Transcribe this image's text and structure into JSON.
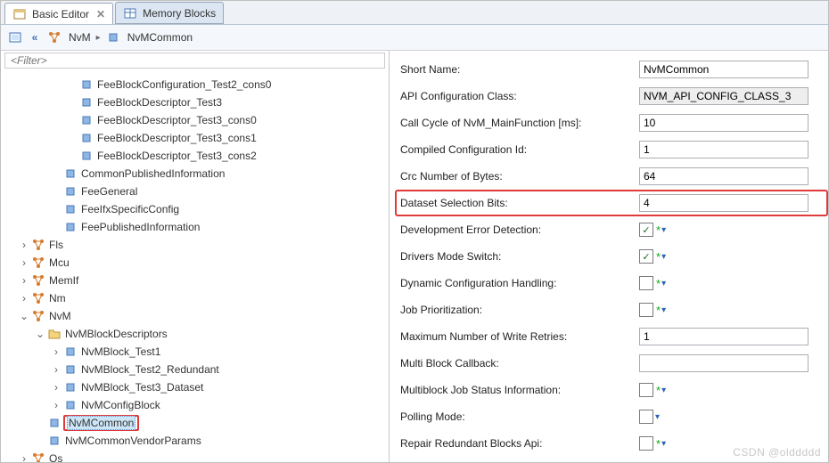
{
  "tabs": {
    "active": "Basic Editor",
    "inactive": "Memory Blocks"
  },
  "filter_placeholder": "<Filter>",
  "breadcrumb": {
    "root": "NvM",
    "leaf": "NvMCommon"
  },
  "tree": [
    {
      "d": 4,
      "t": "",
      "i": "cube",
      "l": "FeeBlockConfiguration_Test2_cons0"
    },
    {
      "d": 4,
      "t": "",
      "i": "cube",
      "l": "FeeBlockDescriptor_Test3"
    },
    {
      "d": 4,
      "t": "",
      "i": "cube",
      "l": "FeeBlockDescriptor_Test3_cons0"
    },
    {
      "d": 4,
      "t": "",
      "i": "cube",
      "l": "FeeBlockDescriptor_Test3_cons1"
    },
    {
      "d": 4,
      "t": "",
      "i": "cube",
      "l": "FeeBlockDescriptor_Test3_cons2"
    },
    {
      "d": 3,
      "t": "",
      "i": "cube",
      "l": "CommonPublishedInformation"
    },
    {
      "d": 3,
      "t": "",
      "i": "cube",
      "l": "FeeGeneral"
    },
    {
      "d": 3,
      "t": "",
      "i": "cube",
      "l": "FeeIfxSpecificConfig"
    },
    {
      "d": 3,
      "t": "",
      "i": "cube",
      "l": "FeePublishedInformation"
    },
    {
      "d": 1,
      "t": ">",
      "i": "mod",
      "l": "Fls"
    },
    {
      "d": 1,
      "t": ">",
      "i": "mod",
      "l": "Mcu"
    },
    {
      "d": 1,
      "t": ">",
      "i": "mod",
      "l": "MemIf"
    },
    {
      "d": 1,
      "t": ">",
      "i": "mod",
      "l": "Nm"
    },
    {
      "d": 1,
      "t": "v",
      "i": "mod",
      "l": "NvM"
    },
    {
      "d": 2,
      "t": "v",
      "i": "fold",
      "l": "NvMBlockDescriptors"
    },
    {
      "d": 3,
      "t": ">",
      "i": "cube",
      "l": "NvMBlock_Test1"
    },
    {
      "d": 3,
      "t": ">",
      "i": "cube",
      "l": "NvMBlock_Test2_Redundant"
    },
    {
      "d": 3,
      "t": ">",
      "i": "cube",
      "l": "NvMBlock_Test3_Dataset"
    },
    {
      "d": 3,
      "t": ">",
      "i": "cube",
      "l": "NvMConfigBlock"
    },
    {
      "d": 2,
      "t": "",
      "i": "cube",
      "l": "NvMCommon",
      "sel": true,
      "box": true
    },
    {
      "d": 2,
      "t": "",
      "i": "cube",
      "l": "NvMCommonVendorParams"
    },
    {
      "d": 1,
      "t": ">",
      "i": "mod",
      "l": "Os"
    }
  ],
  "props": [
    {
      "label": "Short Name:",
      "type": "text",
      "value": "NvMCommon"
    },
    {
      "label": "API Configuration Class:",
      "type": "text",
      "value": "NVM_API_CONFIG_CLASS_3",
      "ro": true
    },
    {
      "label": "Call Cycle of NvM_MainFunction [ms]:",
      "type": "text",
      "value": "10"
    },
    {
      "label": "Compiled Configuration Id:",
      "type": "text",
      "value": "1"
    },
    {
      "label": "Crc Number of Bytes:",
      "type": "text",
      "value": "64"
    },
    {
      "label": "Dataset Selection Bits:",
      "type": "text",
      "value": "4",
      "hl": true
    },
    {
      "label": "Development Error Detection:",
      "type": "check",
      "checked": true,
      "star": true,
      "dd": true
    },
    {
      "label": "Drivers Mode Switch:",
      "type": "check",
      "checked": true,
      "star": true,
      "dd": true
    },
    {
      "label": "Dynamic Configuration Handling:",
      "type": "check",
      "checked": false,
      "star": true,
      "dd": true
    },
    {
      "label": "Job Prioritization:",
      "type": "check",
      "checked": false,
      "star": true,
      "dd": true
    },
    {
      "label": "Maximum Number of Write Retries:",
      "type": "text",
      "value": "1"
    },
    {
      "label": "Multi Block Callback:",
      "type": "text",
      "value": ""
    },
    {
      "label": "Multiblock Job Status Information:",
      "type": "check",
      "checked": false,
      "star": true,
      "dd": true
    },
    {
      "label": "Polling Mode:",
      "type": "check",
      "checked": false,
      "dd": true
    },
    {
      "label": "Repair Redundant Blocks Api:",
      "type": "check",
      "checked": false,
      "star": true,
      "dd": true
    }
  ],
  "watermark": "CSDN @olddddd"
}
